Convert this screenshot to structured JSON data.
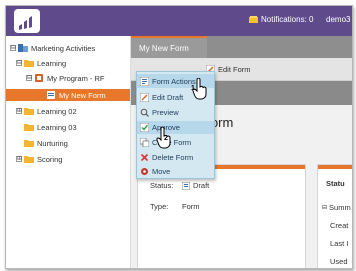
{
  "topbar": {
    "notifications_label": "Notifications: 0",
    "user_label": "demo3"
  },
  "tree": {
    "items": [
      {
        "label": "Marketing Activities",
        "expander": "⊟"
      },
      {
        "label": "Learning",
        "expander": "⊟"
      },
      {
        "label": "My Program - RF",
        "expander": "⊟"
      },
      {
        "label": "My New Form",
        "expander": ""
      },
      {
        "label": "Learning 02",
        "expander": "⊞"
      },
      {
        "label": "Learning 03",
        "expander": ""
      },
      {
        "label": "Nurturing",
        "expander": ""
      },
      {
        "label": "Scoring",
        "expander": "⊞"
      }
    ]
  },
  "content": {
    "tab_label": "My New Form",
    "toolbar": {
      "form_actions_label": "Form Actions",
      "edit_form_label": "Edit Form"
    },
    "title": "Form",
    "details": {
      "status_key": "Status:",
      "status_value": "Draft",
      "type_key": "Type:",
      "type_value": "Form"
    },
    "status_panel": {
      "title": "Statu",
      "rows": [
        "Summ",
        "Creat",
        "Last I",
        "Used"
      ]
    }
  },
  "menu": {
    "items": [
      "Edit Draft",
      "Preview",
      "Approve",
      "Clone Form",
      "Delete Form",
      "Move"
    ]
  },
  "cursors": {
    "step1": "1",
    "step2": "2"
  },
  "colors": {
    "header": "#5f4b8b",
    "accent": "#e8762b",
    "menu_bg": "#d4e8f2"
  }
}
